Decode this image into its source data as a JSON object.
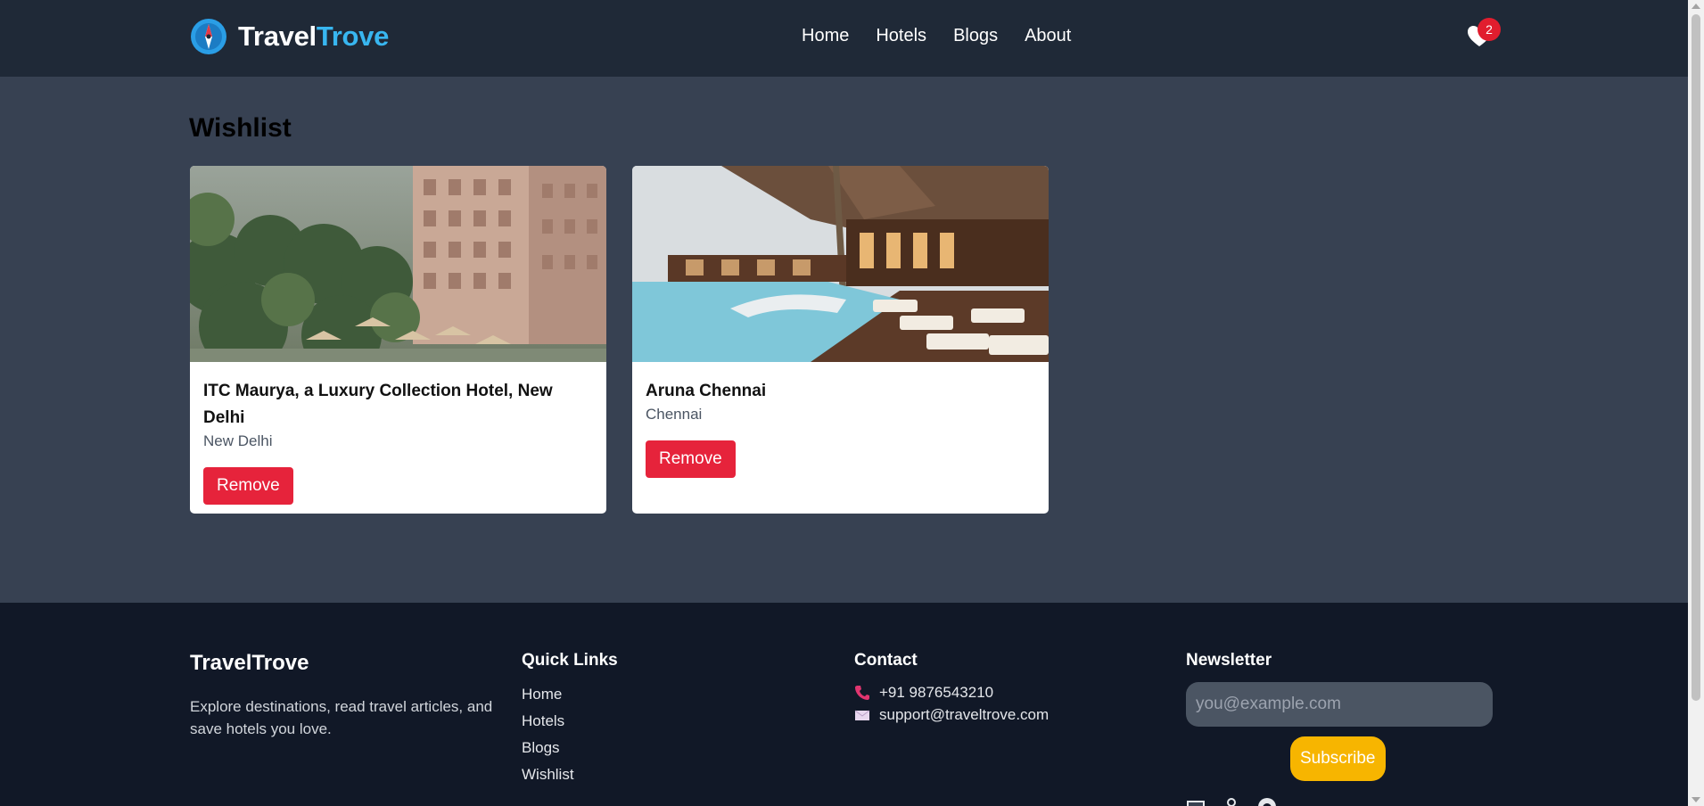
{
  "app": {
    "brand_part1": "Travel",
    "brand_part2": "Trove",
    "accent_color": "#38b6f0",
    "logo_icon": "compass-icon"
  },
  "nav": {
    "items": [
      {
        "label": "Home"
      },
      {
        "label": "Hotels"
      },
      {
        "label": "Blogs"
      },
      {
        "label": "About"
      }
    ],
    "wishlist_icon": "heart-icon",
    "wishlist_count": "2",
    "badge_color": "#e11d2e"
  },
  "main": {
    "title": "Wishlist",
    "cards": [
      {
        "name": "ITC Maurya, a Luxury Collection Hotel, New Delhi",
        "city": "New Delhi",
        "remove_label": "Remove"
      },
      {
        "name": "Aruna Chennai",
        "city": "Chennai",
        "remove_label": "Remove"
      }
    ],
    "remove_color": "#e6233b"
  },
  "footer": {
    "brand": "TravelTrove",
    "description": "Explore destinations, read travel articles, and save hotels you love.",
    "quick_links": {
      "heading": "Quick Links",
      "items": [
        "Home",
        "Hotels",
        "Blogs",
        "Wishlist"
      ]
    },
    "contact": {
      "heading": "Contact",
      "phone": "+91 9876543210",
      "phone_icon": "phone-icon",
      "email": "support@traveltrove.com",
      "email_icon": "envelope-icon"
    },
    "newsletter": {
      "heading": "Newsletter",
      "placeholder": "you@example.com",
      "button_label": "Subscribe",
      "button_color": "#f7b500"
    },
    "social_icons": [
      "image-icon",
      "person-icon",
      "github-icon"
    ]
  }
}
